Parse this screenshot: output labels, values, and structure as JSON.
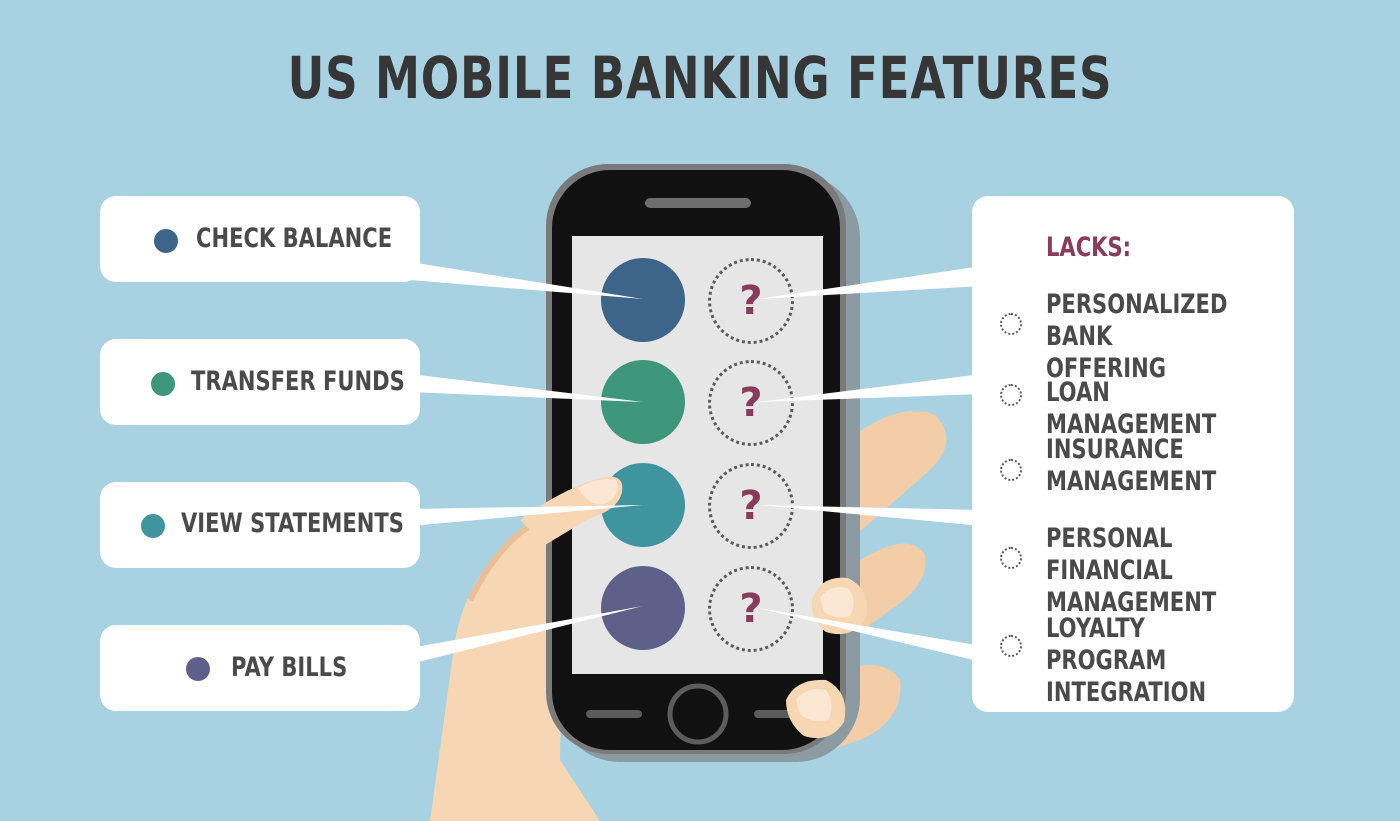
{
  "title": "US MOBILE BANKING FEATURES",
  "features": [
    {
      "label": "CHECK BALANCE",
      "color": "#3d6489"
    },
    {
      "label": "TRANSFER FUNDS",
      "color": "#3e967b"
    },
    {
      "label": "VIEW STATEMENTS",
      "color": "#3f959e"
    },
    {
      "label": "PAY BILLS",
      "color": "#5f6089"
    }
  ],
  "lacks": {
    "title": "LACKS:",
    "items": [
      "PERSONALIZED\nBANK OFFERING",
      "LOAN MANAGEMENT",
      "INSURANCE\nMANAGEMENT",
      "PERSONAL FINANCIAL\nMANAGEMENT",
      "LOYALTY PROGRAM\nINTEGRATION"
    ]
  },
  "question_mark": "?",
  "colors": {
    "background": "#a8d2e1",
    "title_text": "#363636",
    "lacks_accent": "#8a3a5a",
    "phone_body": "#111111",
    "screen": "#e6e6e6",
    "skin": "#f7d6b3"
  }
}
